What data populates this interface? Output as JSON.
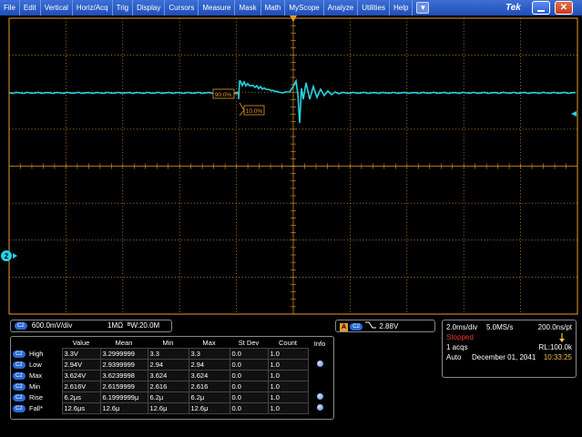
{
  "menu": [
    "File",
    "Edit",
    "Vertical",
    "Horiz/Acq",
    "Trig",
    "Display",
    "Cursors",
    "Measure",
    "Mask",
    "Math",
    "MyScope",
    "Analyze",
    "Utilities",
    "Help"
  ],
  "brand": "Tek",
  "colors": {
    "trace": "#27d3e6",
    "grid": "#e89a2a",
    "accent": "#2a6ad6",
    "stopped": "#e83a2a",
    "time": "#f2c440"
  },
  "cursors": {
    "upper_label": "90.0%",
    "lower_label": "10.0%"
  },
  "channel_marker": "2",
  "channel_settings": {
    "chip": "C2",
    "volts_div": "600.0mV/div",
    "impedance": "1MΩ",
    "bandwidth": "ᴮW:20.0M"
  },
  "trigger": {
    "letter": "A",
    "chip": "C2",
    "level": "2.88V"
  },
  "acquisition": {
    "time_div": "2.0ms/div",
    "sample_rate": "5.0MS/s",
    "resolution": "200.0ns/pt",
    "state": "Stopped",
    "acqs": "1 acqs",
    "record_length": "RL:100.0k",
    "mode": "Auto",
    "date": "December 01, 2041",
    "time": "10:33:25"
  },
  "measurements": {
    "headers": [
      "Value",
      "Mean",
      "Min",
      "Max",
      "St Dev",
      "Count",
      "Info"
    ],
    "rows": [
      {
        "chip": "C2",
        "name": "High",
        "value": "3.3V",
        "mean": "3.2999999",
        "min": "3.3",
        "max": "3.3",
        "stdev": "0.0",
        "count": "1.0",
        "info": false
      },
      {
        "chip": "C2",
        "name": "Low",
        "value": "2.94V",
        "mean": "2.9399999",
        "min": "2.94",
        "max": "2.94",
        "stdev": "0.0",
        "count": "1.0",
        "info": true
      },
      {
        "chip": "C2",
        "name": "Max",
        "value": "3.624V",
        "mean": "3.6239998",
        "min": "3.624",
        "max": "3.624",
        "stdev": "0.0",
        "count": "1.0",
        "info": false
      },
      {
        "chip": "C2",
        "name": "Min",
        "value": "2.616V",
        "mean": "2.6159999",
        "min": "2.616",
        "max": "2.616",
        "stdev": "0.0",
        "count": "1.0",
        "info": false
      },
      {
        "chip": "C2",
        "name": "Rise",
        "value": "6.2μs",
        "mean": "6.1999999μ",
        "min": "6.2μ",
        "max": "6.2μ",
        "stdev": "0.0",
        "count": "1.0",
        "info": true
      },
      {
        "chip": "C2",
        "name": "Fall*",
        "value": "12.6μs",
        "mean": "12.6μ",
        "min": "12.6μ",
        "max": "12.6μ",
        "stdev": "0.0",
        "count": "1.0",
        "info": true
      }
    ]
  }
}
